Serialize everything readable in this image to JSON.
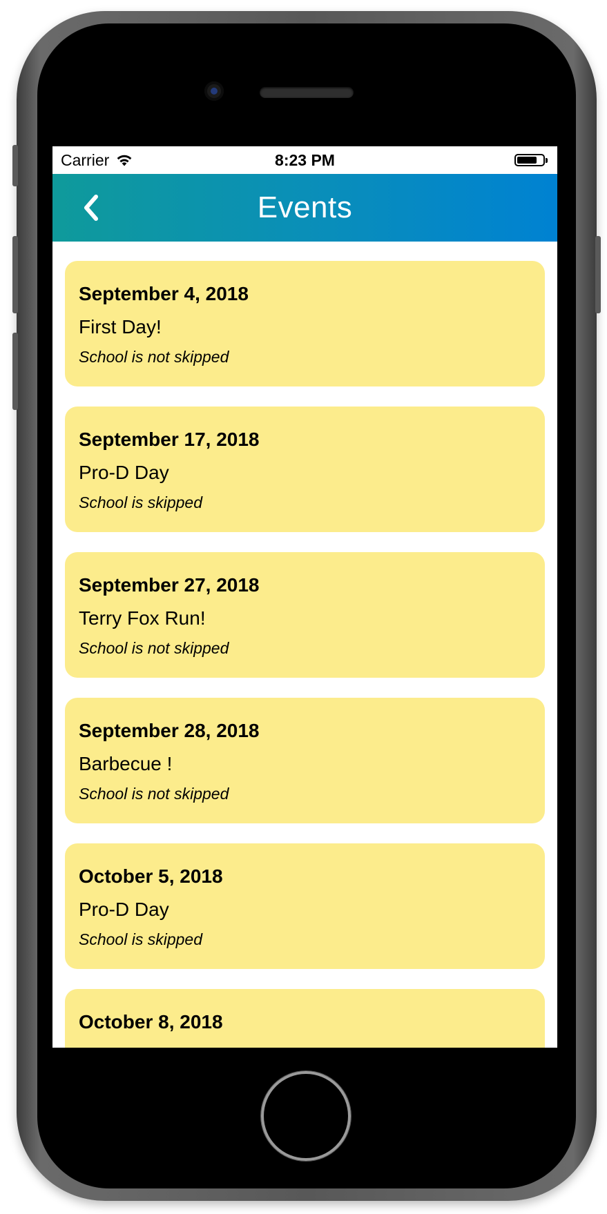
{
  "status_bar": {
    "carrier": "Carrier",
    "time": "8:23 PM",
    "wifi_icon": "wifi-icon",
    "battery_icon": "battery-icon"
  },
  "nav": {
    "title": "Events",
    "back_icon": "chevron-left-icon"
  },
  "colors": {
    "nav_gradient_start": "#0f9a9b",
    "nav_gradient_end": "#0082d2",
    "card_background": "#fcec8c"
  },
  "events": [
    {
      "date": "September 4, 2018",
      "name": "First Day!",
      "note": "School is not skipped"
    },
    {
      "date": "September 17, 2018",
      "name": "Pro-D Day",
      "note": "School is skipped"
    },
    {
      "date": "September 27, 2018",
      "name": "Terry Fox Run!",
      "note": "School is not skipped"
    },
    {
      "date": "September 28, 2018",
      "name": "Barbecue !",
      "note": "School is not skipped"
    },
    {
      "date": "October 5, 2018",
      "name": "Pro-D Day",
      "note": "School is skipped"
    },
    {
      "date": "October 8, 2018",
      "name": "",
      "note": ""
    }
  ]
}
